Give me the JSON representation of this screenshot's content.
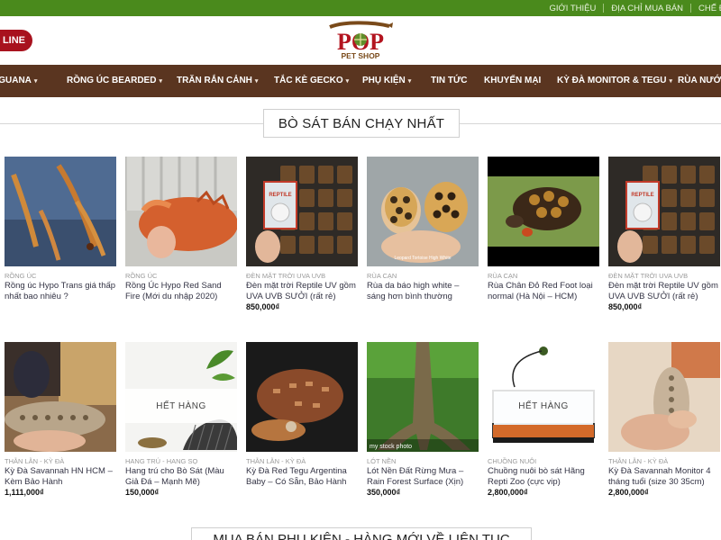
{
  "topbar": {
    "links": [
      "GIỚI THIỆU",
      "ĐỊA CHỈ MUA BÁN",
      "CHẾ ĐỘ"
    ]
  },
  "header": {
    "online_label": "LINE",
    "logo_text_top": "POP",
    "logo_text_bottom": "PET SHOP"
  },
  "nav": {
    "items": [
      {
        "label": "Ỳ IGUANA",
        "caret": true
      },
      {
        "label": "RỒNG ÚC BEARDED",
        "caret": true
      },
      {
        "label": "TRĂN RẮN CẢNH",
        "caret": true
      },
      {
        "label": "TẮC KÈ GECKO",
        "caret": true
      },
      {
        "label": "PHỤ KIỆN",
        "caret": true
      },
      {
        "label": "TIN TỨC",
        "caret": false
      },
      {
        "label": "KHUYẾN MẠI",
        "caret": false
      },
      {
        "label": "KỲ ĐÀ MONITOR & TEGU",
        "caret": true
      },
      {
        "label": "RÙA NƯỚC",
        "caret": false
      }
    ]
  },
  "section": {
    "title": "BÒ SÁT BÁN CHẠY NHẤT",
    "bottom_title": "MUA BÁN PHỤ KIỆN - HÀNG MỚI VỀ LIÊN TỤC"
  },
  "products": [
    {
      "category": "RỒNG ÚC",
      "name": "Rồng úc Hypo Trans giá thấp nhất bao nhiêu ?",
      "price": "",
      "soldout": "",
      "img": "dragons"
    },
    {
      "category": "RỒNG ÚC",
      "name": "Rồng Úc Hypo Red Sand Fire (Mới du nhập 2020)",
      "price": "",
      "soldout": "",
      "img": "reddragon"
    },
    {
      "category": "ĐÈN MẶT TRỜI UVA UVB",
      "name": "Đèn mặt trời Reptile UV gồm UVA UVB SƯỞI (rất rẻ)",
      "price": "850,000₫",
      "soldout": "",
      "img": "lamp"
    },
    {
      "category": "RÙA CẠN",
      "name": "Rùa da báo high white – sáng hơn bình thường",
      "price": "",
      "soldout": "",
      "img": "leopard"
    },
    {
      "category": "RÙA CẠN",
      "name": "Rùa Chân Đỏ Red Foot loại normal (Hà Nội – HCM)",
      "price": "",
      "soldout": "",
      "img": "redfoot"
    },
    {
      "category": "ĐÈN MẶT TRỜI UVA UVB",
      "name": "Đèn mặt trời Reptile UV gồm UVA UVB SƯỞI (rất rẻ)",
      "price": "850,000₫",
      "soldout": "",
      "img": "lamp"
    },
    {
      "category": "THẰN LẰN - KỲ ĐÀ",
      "name": "Kỳ Đà Savannah HN HCM – Kèm Bảo Hành",
      "price": "1,111,000₫",
      "soldout": "",
      "img": "savannah"
    },
    {
      "category": "HANG TRÚ - HANG SỌ",
      "name": "Hang trú cho Bò Sát (Màu Giả Đá – Mạnh Mẽ)",
      "price": "150,000₫",
      "soldout": "HẾT HÀNG",
      "img": "hide"
    },
    {
      "category": "THẰN LẰN - KỲ ĐÀ",
      "name": "Kỳ Đà Red Tegu Argentina Baby – Có Sẵn, Bảo Hành",
      "price": "",
      "soldout": "",
      "img": "tegu"
    },
    {
      "category": "LÓT NỀN",
      "name": "Lót Nền Đất Rừng Mưa – Rain Forest Surface (Xịn)",
      "price": "350,000₫",
      "soldout": "",
      "img": "tree",
      "img_caption": "my stock photo"
    },
    {
      "category": "CHUỒNG NUÔI",
      "name": "Chuồng nuôi bò sát Hãng Repti Zoo (cực vip)",
      "price": "2,800,000₫",
      "soldout": "HẾT HÀNG",
      "img": "cage"
    },
    {
      "category": "THẰN LẰN - KỲ ĐÀ",
      "name": "Kỳ Đà Savannah Monitor 4 tháng tuổi (size 30 35cm)",
      "price": "2,800,000₫",
      "soldout": "",
      "img": "monitor"
    }
  ],
  "colors": {
    "topbar": "#4a8a1c",
    "nav": "#5a3520",
    "online": "#a8121e"
  }
}
